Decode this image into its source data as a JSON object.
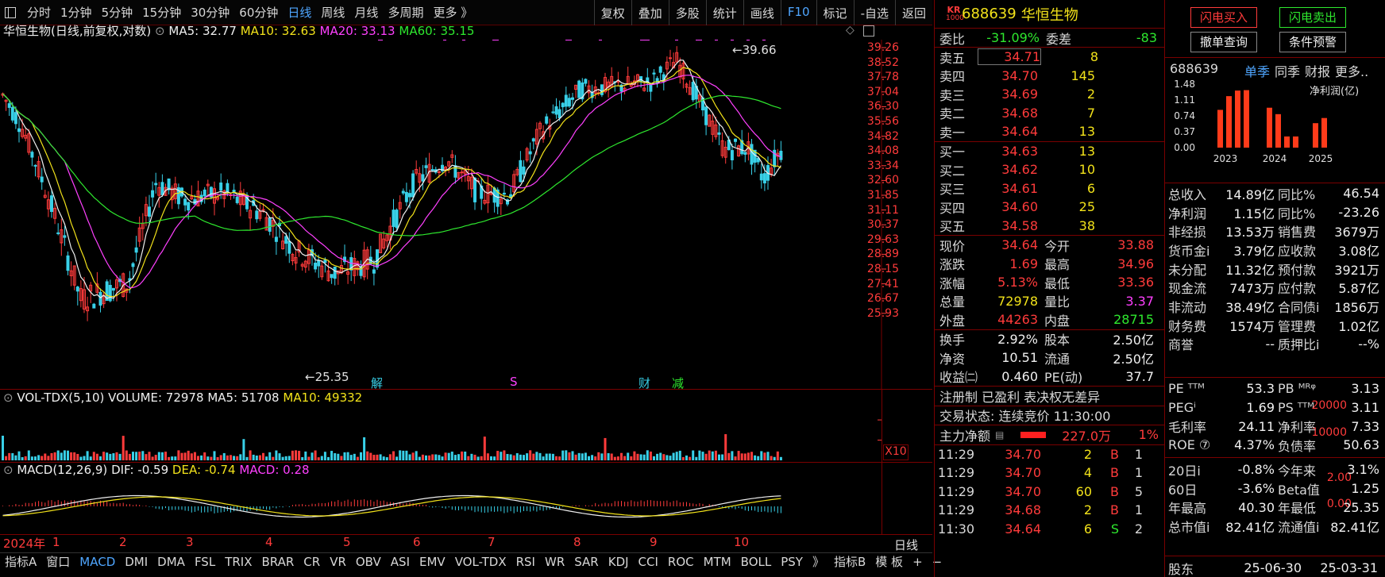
{
  "toolbar": {
    "periods": [
      "分时",
      "1分钟",
      "5分钟",
      "15分钟",
      "30分钟",
      "60分钟",
      "日线",
      "周线",
      "月线",
      "多周期",
      "更多 》"
    ],
    "active_period": "日线",
    "tools": [
      "复权",
      "叠加",
      "多股",
      "统计",
      "画线",
      "F10",
      "标记",
      "-自选",
      "返回"
    ]
  },
  "chart": {
    "stock_title": "华恒生物(日线,前复权,对数)",
    "ma5": "MA5: 32.77",
    "ma10": "MA10: 32.63",
    "ma20": "MA20: 33.13",
    "ma60": "MA60: 35.15",
    "high_label": "39.66",
    "low_label": "25.35",
    "price_ticks": [
      "39.26",
      "38.52",
      "37.78",
      "37.04",
      "36.30",
      "35.56",
      "34.82",
      "34.08",
      "33.34",
      "32.60",
      "31.85",
      "31.11",
      "30.37",
      "29.63",
      "28.89",
      "28.15",
      "27.41",
      "26.67",
      "25.93"
    ],
    "event_marks": [
      {
        "label": "解",
        "color": "#38d0e8"
      },
      {
        "label": "S",
        "color": "#ff40ff"
      },
      {
        "label": "财",
        "color": "#38d0e8"
      },
      {
        "label": "减",
        "color": "#2ee82e"
      }
    ],
    "colors": {
      "up": "#ff3b3b",
      "down": "#38d0e8",
      "ma5": "#f0f0f0",
      "ma10": "#f2e21a",
      "ma20": "#ff40ff",
      "ma60": "#2ee82e"
    }
  },
  "volume": {
    "title": "VOL-TDX(5,10)",
    "volume": "VOLUME: 72978",
    "ma5": "MA5: 51708",
    "ma10": "MA10: 49332",
    "ticks": [
      "20000",
      "10000"
    ],
    "unit_label": "X10"
  },
  "macd": {
    "title": "MACD(12,26,9)",
    "dif": "DIF: -0.59",
    "dea": "DEA: -0.74",
    "macd": "MACD: 0.28",
    "ticks": [
      "2.00",
      "0.00"
    ]
  },
  "x_axis": {
    "labels": [
      "2024年",
      "1",
      "2",
      "3",
      "4",
      "5",
      "6",
      "7",
      "8",
      "9",
      "10"
    ],
    "period_label": "日线"
  },
  "indicator_tabs": [
    "指标A",
    "窗口",
    "MACD",
    "DMI",
    "DMA",
    "FSL",
    "TRIX",
    "BRAR",
    "CR",
    "VR",
    "OBV",
    "ASI",
    "EMV",
    "VOL-TDX",
    "RSI",
    "WR",
    "SAR",
    "KDJ",
    "CCI",
    "ROC",
    "MTM",
    "BOLL",
    "PSY",
    "》",
    "指标B",
    "模 板",
    "+",
    "−"
  ],
  "active_indicator": "MACD",
  "quote": {
    "badge_top": "KR",
    "badge_bottom": "1000",
    "code": "688639",
    "name": "华恒生物",
    "weibi_label": "委比",
    "weibi": "-31.09%",
    "weicha_label": "委差",
    "weicha": "-83",
    "asks": [
      {
        "label": "卖五",
        "price": "34.71",
        "vol": "8"
      },
      {
        "label": "卖四",
        "price": "34.70",
        "vol": "145"
      },
      {
        "label": "卖三",
        "price": "34.69",
        "vol": "2"
      },
      {
        "label": "卖二",
        "price": "34.68",
        "vol": "7"
      },
      {
        "label": "卖一",
        "price": "34.64",
        "vol": "13"
      }
    ],
    "bids": [
      {
        "label": "买一",
        "price": "34.63",
        "vol": "13"
      },
      {
        "label": "买二",
        "price": "34.62",
        "vol": "10"
      },
      {
        "label": "买三",
        "price": "34.61",
        "vol": "6"
      },
      {
        "label": "买四",
        "price": "34.60",
        "vol": "25"
      },
      {
        "label": "买五",
        "price": "34.58",
        "vol": "38"
      }
    ],
    "stats": [
      {
        "l1": "现价",
        "v1": "34.64",
        "c1": "#ff3b3b",
        "l2": "今开",
        "v2": "33.88",
        "c2": "#ff3b3b"
      },
      {
        "l1": "涨跌",
        "v1": "1.69",
        "c1": "#ff3b3b",
        "l2": "最高",
        "v2": "34.96",
        "c2": "#ff3b3b"
      },
      {
        "l1": "涨幅",
        "v1": "5.13%",
        "c1": "#ff3b3b",
        "l2": "最低",
        "v2": "33.36",
        "c2": "#ff3b3b"
      },
      {
        "l1": "总量",
        "v1": "72978",
        "c1": "#f2e21a",
        "l2": "量比",
        "v2": "3.37",
        "c2": "#ff40ff"
      },
      {
        "l1": "外盘",
        "v1": "44263",
        "c1": "#ff3b3b",
        "l2": "内盘",
        "v2": "28715",
        "c2": "#2ee82e"
      }
    ],
    "stats2": [
      {
        "l1": "换手",
        "v1": "2.92%",
        "l2": "股本",
        "v2": "2.50亿"
      },
      {
        "l1": "净资",
        "v1": "10.51",
        "l2": "流通",
        "v2": "2.50亿"
      },
      {
        "l1": "收益㈡",
        "v1": "0.460",
        "l2": "PE(动)",
        "v2": "37.7"
      }
    ],
    "tags": "注册制 已盈利 表决权无差异",
    "trade_status": "交易状态: 连续竞价 11:30:00",
    "main_flow_label": "主力净额",
    "main_flow": "227.0万",
    "main_flow_pct": "1%",
    "ticks": [
      {
        "time": "11:29",
        "price": "34.70",
        "vol": "2",
        "side": "B",
        "n": "1"
      },
      {
        "time": "11:29",
        "price": "34.70",
        "vol": "4",
        "side": "B",
        "n": "1"
      },
      {
        "time": "11:29",
        "price": "34.70",
        "vol": "60",
        "side": "B",
        "n": "5"
      },
      {
        "time": "11:29",
        "price": "34.68",
        "vol": "2",
        "side": "B",
        "n": "1"
      },
      {
        "time": "11:30",
        "price": "34.64",
        "vol": "6",
        "side": "S",
        "n": "2"
      }
    ]
  },
  "fund": {
    "buy_btn": "闪电买入",
    "sell_btn": "闪电卖出",
    "cancel_btn": "撤单查询",
    "alert_btn": "条件预警",
    "code": "688639",
    "tabs": [
      "单季",
      "同季",
      "财报",
      "更多.."
    ],
    "chart_label": "净利润(亿)",
    "chart_data": {
      "type": "bar",
      "title": "净利润(亿)",
      "categories": [
        "2023",
        "2024",
        "2025"
      ],
      "yticks": [
        "1.48",
        "1.11",
        "0.74",
        "0.37",
        "0.00"
      ],
      "ylim": [
        0,
        1.48
      ],
      "series": [
        {
          "group": "2023",
          "values": [
            0.88,
            1.2,
            1.33,
            1.34
          ]
        },
        {
          "group": "2024",
          "values": [
            0.93,
            0.78,
            0.26,
            0.26
          ]
        },
        {
          "group": "2025",
          "values": [
            0.57,
            0.69
          ]
        }
      ]
    },
    "rows": [
      {
        "l1": "总收入",
        "v1": "14.89亿",
        "l2": "同比%",
        "v2": "46.54"
      },
      {
        "l1": "净利润",
        "v1": "1.15亿",
        "l2": "同比%",
        "v2": "-23.26"
      },
      {
        "l1": "非经损",
        "v1": "13.53万",
        "l2": "销售费",
        "v2": "3679万"
      },
      {
        "l1": "货币金i",
        "v1": "3.79亿",
        "l2": "应收款",
        "v2": "3.08亿"
      },
      {
        "l1": "未分配",
        "v1": "11.32亿",
        "l2": "预付款",
        "v2": "3921万"
      },
      {
        "l1": "现金流",
        "v1": "7473万",
        "l2": "应付款",
        "v2": "5.87亿"
      },
      {
        "l1": "非流动",
        "v1": "38.49亿",
        "l2": "合同债i",
        "v2": "1856万"
      },
      {
        "l1": "财务费",
        "v1": "1574万",
        "l2": "管理费",
        "v2": "1.02亿"
      },
      {
        "l1": "商誉",
        "v1": "--",
        "l2": "质押比i",
        "v2": "--%"
      }
    ],
    "rows2": [
      {
        "l1": "PE ᵀᵀᴹ",
        "v1": "53.3",
        "l2": "PB ᴹᴿᵠ",
        "v2": "3.13"
      },
      {
        "l1": "PEGⁱ",
        "v1": "1.69",
        "l2": "PS ᵀᵀᴹ",
        "v2": "3.11"
      },
      {
        "l1": "毛利率",
        "v1": "24.11",
        "l2": "净利率",
        "v2": "7.33"
      },
      {
        "l1": "ROE ⑦",
        "v1": "4.37%",
        "l2": "负债率",
        "v2": "50.63"
      }
    ],
    "rows3": [
      {
        "l1": "20日i",
        "v1": "-0.8%",
        "l2": "今年来",
        "v2": "3.1%"
      },
      {
        "l1": "60日",
        "v1": "-3.6%",
        "l2": "Beta值",
        "v2": "1.25"
      },
      {
        "l1": "年最高",
        "v1": "40.30",
        "l2": "年最低",
        "v2": "25.35"
      },
      {
        "l1": "总市值i",
        "v1": "82.41亿",
        "l2": "流通值i",
        "v2": "82.41亿"
      }
    ],
    "bottom": {
      "l1": "股东",
      "v1": "25-06-30",
      "v2": "25-03-31"
    }
  }
}
